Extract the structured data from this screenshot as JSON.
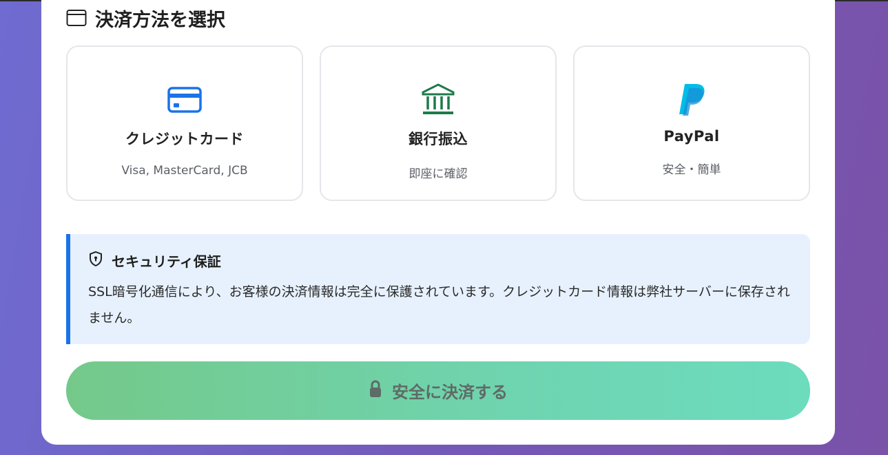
{
  "section": {
    "title": "決済方法を選択",
    "icon": "browser-window-icon"
  },
  "methods": [
    {
      "name": "クレジットカード",
      "desc": "Visa, MasterCard, JCB",
      "icon": "credit-card-icon",
      "color": "#1a73e8"
    },
    {
      "name": "銀行振込",
      "desc": "即座に確認",
      "icon": "bank-icon",
      "color": "#1e7a4a"
    },
    {
      "name": "PayPal",
      "desc": "安全・簡単",
      "icon": "paypal-icon",
      "color": "#009cde"
    }
  ],
  "security": {
    "title": "セキュリティ保証",
    "icon": "shield-icon",
    "text": "SSL暗号化通信により、お客様の決済情報は完全に保護されています。クレジットカード情報は弊社サーバーに保存されません。",
    "accent": "#1a73e8"
  },
  "button": {
    "label": "安全に決済する",
    "icon": "lock-icon"
  }
}
